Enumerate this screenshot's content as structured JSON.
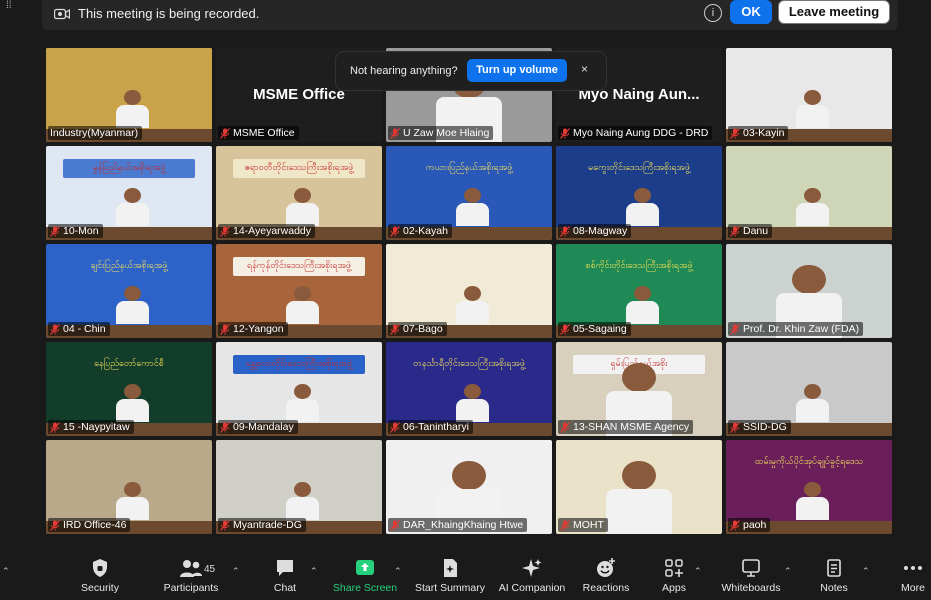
{
  "banner": {
    "message": "This meeting is being recorded.",
    "ok_label": "OK",
    "leave_label": "Leave meeting",
    "info_glyph": "i"
  },
  "popup": {
    "text": "Not hearing anything?",
    "button": "Turn up volume",
    "close": "×"
  },
  "tiles": [
    {
      "name": "Industry(Myanmar)",
      "muted": false,
      "active": true,
      "bg": "#c9a24a",
      "banner": "",
      "bannerBg": "#e0b45a",
      "style": "room"
    },
    {
      "name": "MSME Office",
      "muted": true,
      "bg": "#1e1e1e",
      "big": "MSME Office",
      "style": "blank"
    },
    {
      "name": "U Zaw Moe Hlaing",
      "muted": true,
      "bg": "#9a9a9a",
      "banner": "",
      "style": "face"
    },
    {
      "name": "Myo Naing Aung DDG - DRD",
      "muted": true,
      "bg": "#1e1e1e",
      "big": "Myo Naing Aun...",
      "style": "blank"
    },
    {
      "name": "03-Kayin",
      "muted": true,
      "bg": "#e8e8e8",
      "banner": "",
      "style": "room"
    },
    {
      "name": "10-Mon",
      "muted": true,
      "bg": "#dfe8f2",
      "banner": "မွန်ပြည်နယ်အစိုးရအဖွဲ့",
      "bannerBg": "#4a7bd1",
      "style": "room"
    },
    {
      "name": "14-Ayeyarwaddy",
      "muted": true,
      "bg": "#d8c49a",
      "banner": "ဧရာဝတီတိုင်းဒေသကြီးအစိုးရအဖွဲ့",
      "bannerBg": "#f0e6c8",
      "style": "room"
    },
    {
      "name": "02-Kayah",
      "muted": true,
      "bg": "#2a58b8",
      "banner": "ကယားပြည်နယ်အစိုးရအဖွဲ့",
      "bannerBg": "#2a58b8",
      "style": "room"
    },
    {
      "name": "08-Magway",
      "muted": true,
      "bg": "#1c3e8a",
      "banner": "မကွေးတိုင်းဒေသကြီးအစိုးရအဖွဲ့",
      "bannerBg": "#1c3e8a",
      "style": "room"
    },
    {
      "name": "Danu",
      "muted": true,
      "bg": "#cfd6b8",
      "banner": "",
      "style": "room"
    },
    {
      "name": "04 - Chin",
      "muted": true,
      "bg": "#2d62c8",
      "banner": "ချင်းပြည်နယ်အစိုးရအဖွဲ့",
      "bannerBg": "#2d62c8",
      "style": "room"
    },
    {
      "name": "12-Yangon",
      "muted": true,
      "bg": "#a8643a",
      "banner": "ရန်ကုန်တိုင်းဒေသကြီးအစိုးရအဖွဲ့",
      "bannerBg": "#f4efe2",
      "style": "room"
    },
    {
      "name": "07-Bago",
      "muted": true,
      "bg": "#f1ead6",
      "banner": "",
      "bannerBg": "#8a5a2a",
      "style": "room"
    },
    {
      "name": "05-Sagaing",
      "muted": true,
      "bg": "#1f8a55",
      "banner": "စစ်ကိုင်းတိုင်းဒေသကြီးအစိုးရအဖွဲ့",
      "bannerBg": "#1f8a55",
      "style": "room"
    },
    {
      "name": "Prof. Dr. Khin Zaw (FDA)",
      "muted": true,
      "bg": "#cbd2cf",
      "banner": "",
      "style": "face"
    },
    {
      "name": "15 -Naypyitaw",
      "muted": true,
      "bg": "#123d2a",
      "banner": "နေပြည်တော်ကောင်စီ",
      "bannerBg": "#123d2a",
      "style": "room"
    },
    {
      "name": "09-Mandalay",
      "muted": true,
      "bg": "#e6e6e6",
      "banner": "မန္တလေးတိုင်းဒေသကြီးအစိုးရအဖွဲ့",
      "bannerBg": "#2a62c8",
      "style": "room"
    },
    {
      "name": "06-Tanintharyi",
      "muted": true,
      "bg": "#2a2a8a",
      "banner": "တနင်္သာရီတိုင်းဒေသကြီးအစိုးရအဖွဲ့",
      "bannerBg": "#2a2a8a",
      "style": "room"
    },
    {
      "name": "13-SHAN MSME Agency",
      "muted": true,
      "bg": "#d8d0bd",
      "banner": "ရှမ်းပြည်နယ်အစိုး",
      "bannerBg": "#f2f2f2",
      "style": "face"
    },
    {
      "name": "SSID-DG",
      "muted": true,
      "bg": "#c9c9c9",
      "banner": "",
      "style": "room"
    },
    {
      "name": "IRD Office-46",
      "muted": true,
      "bg": "#b9a98a",
      "banner": "",
      "style": "room"
    },
    {
      "name": "Myantrade-DG",
      "muted": true,
      "bg": "#d0d0c8",
      "banner": "",
      "bannerBg": "#d8c86a",
      "style": "room"
    },
    {
      "name": "DAR_KhaingKhaing Htwe",
      "muted": true,
      "bg": "#f0f0f0",
      "banner": "",
      "style": "face"
    },
    {
      "name": "MOHT",
      "muted": true,
      "bg": "#e9e2c9",
      "banner": "",
      "style": "face"
    },
    {
      "name": "paoh",
      "muted": true,
      "bg": "#6a1f5a",
      "banner": "ထမ်းမှုကိုယ်ပိုင်အုပ်ချုပ်ခွင့်ရဒေသ",
      "bannerBg": "#6a1f5a",
      "style": "room"
    }
  ],
  "toolbar": {
    "security": "Security",
    "participants": "Participants",
    "participant_count": "45",
    "chat": "Chat",
    "share_screen": "Share Screen",
    "start_summary": "Start Summary",
    "ai_companion": "AI Companion",
    "reactions": "Reactions",
    "apps": "Apps",
    "whiteboards": "Whiteboards",
    "notes": "Notes",
    "more": "More",
    "accent": "#26d07c"
  }
}
